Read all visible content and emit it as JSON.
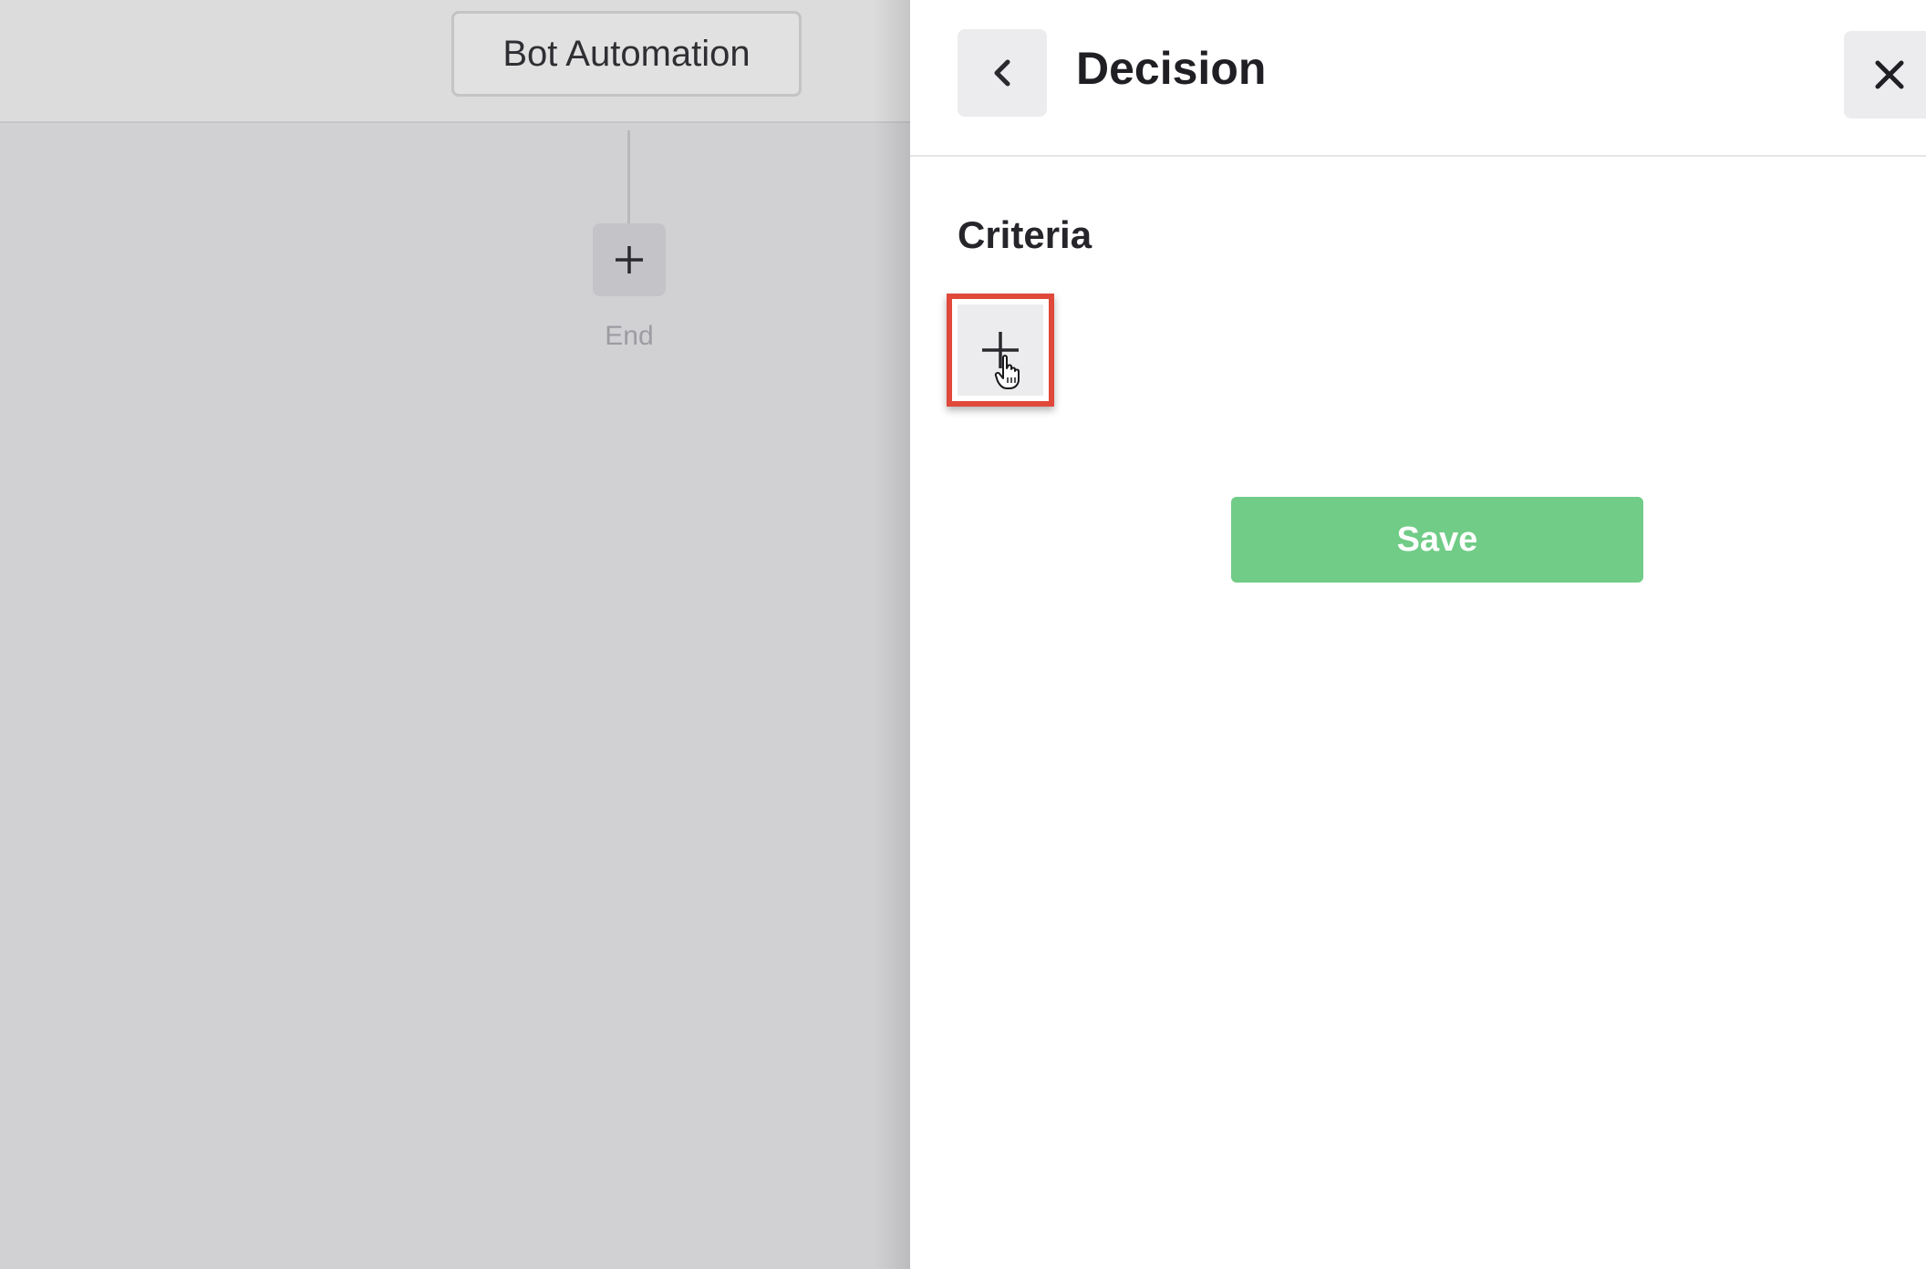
{
  "canvas": {
    "trigger_label": "Bot Automation",
    "end_label": "End"
  },
  "panel": {
    "title": "Decision",
    "section_label": "Criteria",
    "save_label": "Save"
  },
  "colors": {
    "save_button": "#70cc86",
    "highlight_border": "#e0483a",
    "canvas_background": "#d1d1d4"
  },
  "icons": {
    "back": "chevron-left-icon",
    "close": "close-icon",
    "add": "plus-icon",
    "cursor": "hand-pointer-icon"
  }
}
